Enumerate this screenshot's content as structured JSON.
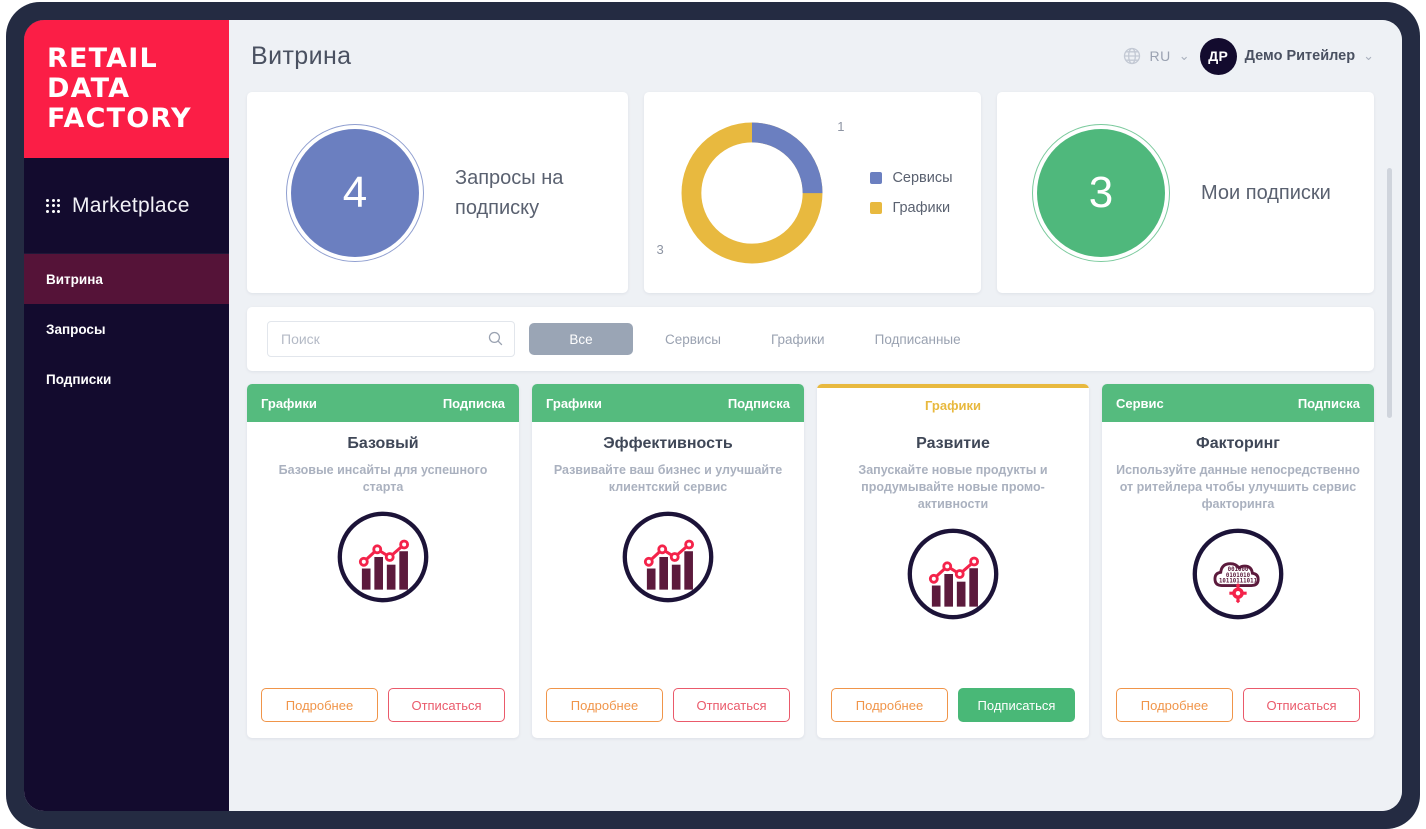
{
  "brand": {
    "lines": [
      "RETAIL",
      "DATA",
      "FACTORY"
    ],
    "red": "#fb1e46"
  },
  "sidebar": {
    "marketplace_label": "Marketplace",
    "grid_icon": "grid-dots-icon",
    "items": [
      {
        "label": "Витрина",
        "active": true
      },
      {
        "label": "Запросы",
        "active": false
      },
      {
        "label": "Подписки",
        "active": false
      }
    ]
  },
  "header": {
    "title": "Витрина",
    "language": {
      "icon": "globe-icon",
      "code": "RU",
      "caret": "⌄"
    },
    "user": {
      "initials": "ДР",
      "name": "Демо Ритейлер",
      "caret": "⌄"
    }
  },
  "stats": {
    "requests": {
      "value": "4",
      "label": "Запросы на подписку",
      "color": "#6b7fc0"
    },
    "subscriptions": {
      "value": "3",
      "label": "Мои подписки",
      "color": "#4fb87c"
    }
  },
  "chart_data": {
    "type": "pie",
    "title": "",
    "categories": [
      "Сервисы",
      "Графики"
    ],
    "values": [
      1,
      3
    ],
    "colors": [
      "#6b7fc0",
      "#e8b93f"
    ],
    "labels": [
      "1",
      "3"
    ],
    "legend_position": "right",
    "donut": true,
    "total": 4
  },
  "filters": {
    "search": {
      "value": "",
      "placeholder": "Поиск",
      "icon": "search-icon"
    },
    "chips": [
      {
        "label": "Все",
        "active": true
      },
      {
        "label": "Сервисы",
        "active": false
      },
      {
        "label": "Графики",
        "active": false
      },
      {
        "label": "Подписанные",
        "active": false
      }
    ]
  },
  "cards": [
    {
      "tag": "Графики",
      "status": "Подписка",
      "head_style": "green",
      "title": "Базовый",
      "desc": "Базовые инсайты для успешного старта",
      "icon": "bar-line-chart-icon",
      "primary_btn": {
        "label": "Подробнее",
        "style": "outline-orange"
      },
      "secondary_btn": {
        "label": "Отписаться",
        "style": "outline-red"
      }
    },
    {
      "tag": "Графики",
      "status": "Подписка",
      "head_style": "green",
      "title": "Эффективность",
      "desc": "Развивайте ваш бизнес и улучшайте клиентский сервис",
      "icon": "bar-line-chart-icon",
      "primary_btn": {
        "label": "Подробнее",
        "style": "outline-orange"
      },
      "secondary_btn": {
        "label": "Отписаться",
        "style": "outline-red"
      }
    },
    {
      "tag": "Графики",
      "status": "",
      "head_style": "yellow",
      "title": "Развитие",
      "desc": "Запускайте новые продукты и продумывайте новые промо-активности",
      "icon": "bar-line-chart-icon",
      "primary_btn": {
        "label": "Подробнее",
        "style": "outline-orange"
      },
      "secondary_btn": {
        "label": "Подписаться",
        "style": "solid-green"
      }
    },
    {
      "tag": "Сервис",
      "status": "Подписка",
      "head_style": "green",
      "title": "Факторинг",
      "desc": "Используйте данные непосредственно от ритейлера чтобы улучшить сервис факторинга",
      "icon": "cloud-binary-gear-icon",
      "primary_btn": {
        "label": "Подробнее",
        "style": "outline-orange"
      },
      "secondary_btn": {
        "label": "Отписаться",
        "style": "outline-red"
      }
    }
  ]
}
